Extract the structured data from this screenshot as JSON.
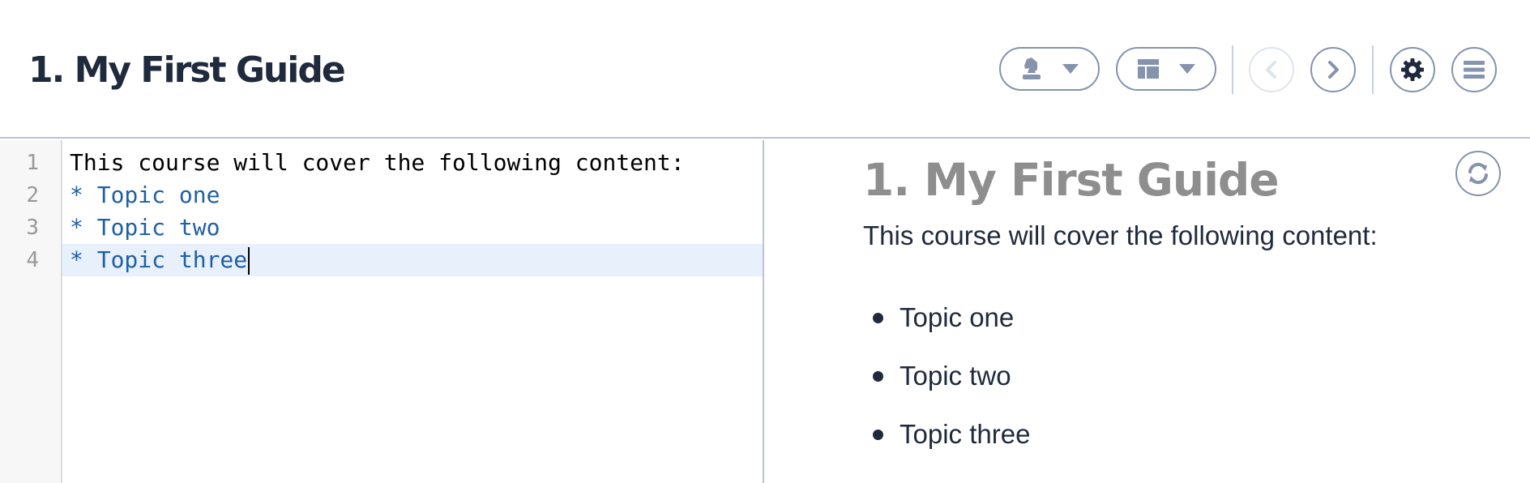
{
  "header": {
    "title": "1. My First Guide",
    "toolbar": {
      "style_menu_icon": "chess-knight-icon",
      "layout_menu_icon": "layout-icon",
      "prev_icon": "chevron-left-icon",
      "prev_enabled": false,
      "next_icon": "chevron-right-icon",
      "next_enabled": true,
      "settings_icon": "gear-icon",
      "menu_icon": "hamburger-icon"
    }
  },
  "editor": {
    "active_line": 4,
    "lines": [
      {
        "number": "1",
        "text": "This course will cover the following content:"
      },
      {
        "number": "2",
        "text": "* Topic one"
      },
      {
        "number": "3",
        "text": "* Topic two"
      },
      {
        "number": "4",
        "text": "* Topic three"
      }
    ]
  },
  "preview": {
    "title": "1. My First Guide",
    "intro": "This course will cover the following content:",
    "items": [
      "Topic one",
      "Topic two",
      "Topic three"
    ],
    "refresh_icon": "refresh-icon"
  },
  "colors": {
    "heading": "#1f2a3c",
    "button_border": "#8593ad",
    "code_list": "#1f5fa6",
    "active_line_bg": "#e7f0fb",
    "preview_title": "#8e8e8e"
  }
}
